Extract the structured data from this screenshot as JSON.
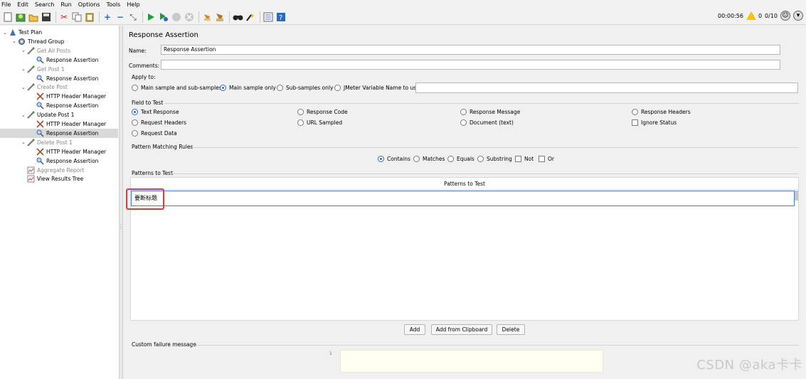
{
  "menu": [
    "File",
    "Edit",
    "Search",
    "Run",
    "Options",
    "Tools",
    "Help"
  ],
  "toolbar": {
    "icons": [
      "new-icon",
      "templates-icon",
      "open-icon",
      "save-icon",
      "cut-icon",
      "copy-icon",
      "paste-icon",
      "expand-icon",
      "collapse-icon",
      "toggle-icon",
      "start-icon",
      "start-no-pause-icon",
      "stop-icon",
      "shutdown-icon",
      "clear-icon",
      "clear-all-icon",
      "search-icon",
      "reset-search-icon",
      "function-helper-icon",
      "help-icon"
    ],
    "timer": "00:00:56",
    "warnings": "0",
    "threads": "0/10"
  },
  "tree": [
    {
      "label": "Test Plan",
      "icon": "test-plan-icon",
      "toggle": "v",
      "disabled": false,
      "selected": false
    },
    {
      "label": "Thread Group",
      "icon": "gear-icon",
      "toggle": "v",
      "disabled": false,
      "selected": false
    },
    {
      "label": "Get All Posts",
      "icon": "sampler-icon",
      "toggle": "v",
      "disabled": true,
      "selected": false
    },
    {
      "label": "Response Assertion",
      "icon": "magnifier-icon",
      "toggle": "",
      "disabled": false,
      "selected": false
    },
    {
      "label": "Get Post 1",
      "icon": "sampler-icon",
      "toggle": "v",
      "disabled": true,
      "selected": false
    },
    {
      "label": "Response Assertion",
      "icon": "magnifier-icon",
      "toggle": "",
      "disabled": false,
      "selected": false
    },
    {
      "label": "Create Post",
      "icon": "sampler-icon",
      "toggle": "v",
      "disabled": true,
      "selected": false
    },
    {
      "label": "HTTP Header Manager",
      "icon": "tools-icon",
      "toggle": "",
      "disabled": false,
      "selected": false
    },
    {
      "label": "Response Assertion",
      "icon": "magnifier-icon",
      "toggle": "",
      "disabled": false,
      "selected": false
    },
    {
      "label": "Update Post 1",
      "icon": "sampler-icon",
      "toggle": "v",
      "disabled": false,
      "selected": false
    },
    {
      "label": "HTTP Header Manager",
      "icon": "tools-icon",
      "toggle": "",
      "disabled": false,
      "selected": false
    },
    {
      "label": "Response Assertion",
      "icon": "magnifier-icon",
      "toggle": "",
      "disabled": false,
      "selected": true
    },
    {
      "label": "Delete Post 1",
      "icon": "sampler-icon",
      "toggle": "v",
      "disabled": true,
      "selected": false
    },
    {
      "label": "HTTP Header Manager",
      "icon": "tools-icon",
      "toggle": "",
      "disabled": false,
      "selected": false
    },
    {
      "label": "Response Assertion",
      "icon": "magnifier-icon",
      "toggle": "",
      "disabled": false,
      "selected": false
    },
    {
      "label": "Aggregate Report",
      "icon": "report-icon",
      "toggle": "",
      "disabled": true,
      "selected": false
    },
    {
      "label": "View Results Tree",
      "icon": "report-icon",
      "toggle": "",
      "disabled": false,
      "selected": false
    }
  ],
  "panel": {
    "title": "Response Assertion",
    "name_label": "Name:",
    "name_value": "Response Assertion",
    "comments_label": "Comments:",
    "comments_value": "",
    "apply_to": {
      "title": "Apply to:",
      "options": [
        "Main sample and sub-samples",
        "Main sample only",
        "Sub-samples only",
        "JMeter Variable Name to use"
      ],
      "selected": 1,
      "variable_value": ""
    },
    "field_to_test": {
      "title": "Field to Test",
      "options": [
        "Text Response",
        "Response Code",
        "Response Message",
        "Response Headers",
        "Request Headers",
        "URL Sampled",
        "Document (text)",
        "Ignore Status",
        "Request Data"
      ],
      "selected": 0
    },
    "pattern_rules": {
      "title": "Pattern Matching Rules",
      "options": [
        "Contains",
        "Matches",
        "Equals",
        "Substring"
      ],
      "selected": 0,
      "checks": [
        "Not",
        "Or"
      ]
    },
    "patterns": {
      "title": "Patterns to Test",
      "column": "Patterns to Test",
      "rows": [
        "要断标题"
      ]
    },
    "buttons": [
      "Add",
      "Add from Clipboard",
      "Delete"
    ],
    "failure_message": {
      "title": "Custom failure message",
      "line": "1",
      "value": ""
    }
  },
  "watermark": "CSDN @aka卡卡"
}
